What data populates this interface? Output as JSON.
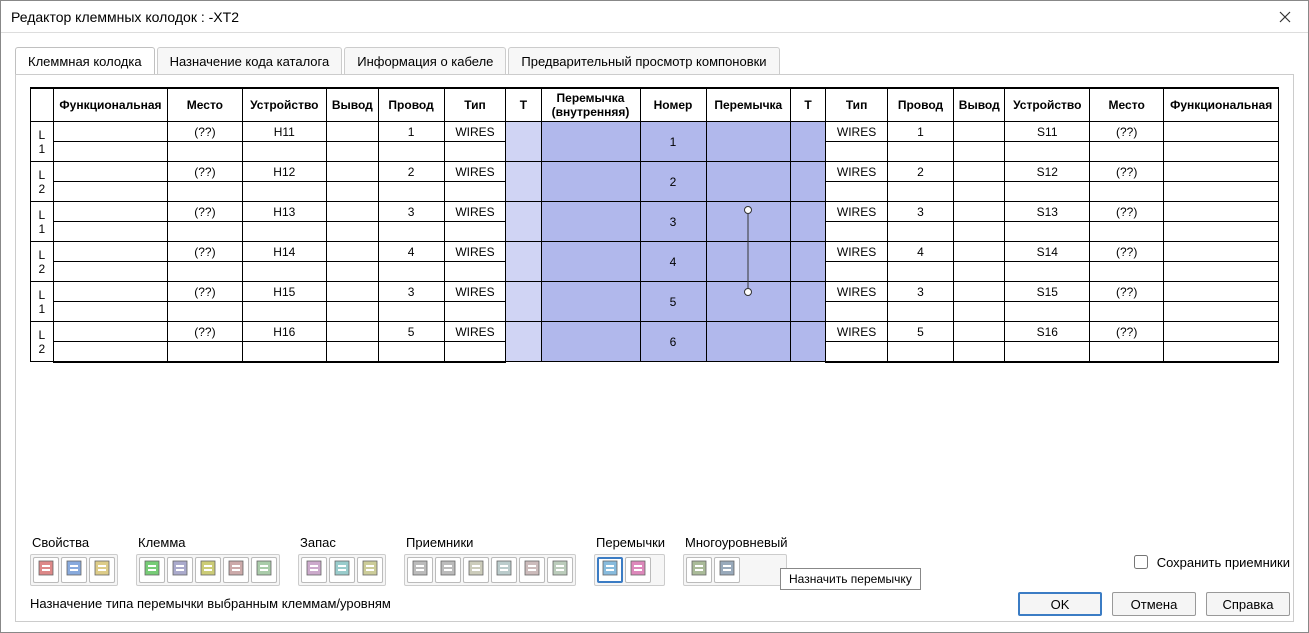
{
  "title": "Редактор клеммных колодок : -XT2",
  "tabs": [
    {
      "label": "Клеммная колодка",
      "active": true
    },
    {
      "label": "Назначение кода каталога",
      "active": false
    },
    {
      "label": "Информация о кабеле",
      "active": false
    },
    {
      "label": "Предварительный просмотр компоновки",
      "active": false
    }
  ],
  "headers": {
    "rownum": "",
    "left": [
      "Функциональная",
      "Место",
      "Устройство",
      "Вывод",
      "Провод",
      "Тип"
    ],
    "center": [
      "T",
      "Перемычка (внутренняя)",
      "Номер",
      "Перемычка",
      "T"
    ],
    "right": [
      "Тип",
      "Провод",
      "Вывод",
      "Устройство",
      "Место",
      "Функциональная"
    ]
  },
  "rows": [
    {
      "level": "L 1",
      "l_place": "(??)",
      "l_dev": "H11",
      "l_pin": "",
      "l_wire": "1",
      "l_type": "WIRES",
      "num": "1",
      "jumper": false,
      "r_type": "WIRES",
      "r_wire": "1",
      "r_pin": "",
      "r_dev": "S11",
      "r_place": "(??)"
    },
    {
      "level": "L 2",
      "l_place": "(??)",
      "l_dev": "H12",
      "l_pin": "",
      "l_wire": "2",
      "l_type": "WIRES",
      "num": "2",
      "jumper": false,
      "r_type": "WIRES",
      "r_wire": "2",
      "r_pin": "",
      "r_dev": "S12",
      "r_place": "(??)"
    },
    {
      "level": "L 1",
      "l_place": "(??)",
      "l_dev": "H13",
      "l_pin": "",
      "l_wire": "3",
      "l_type": "WIRES",
      "num": "3",
      "jumper": "start",
      "r_type": "WIRES",
      "r_wire": "3",
      "r_pin": "",
      "r_dev": "S13",
      "r_place": "(??)"
    },
    {
      "level": "L 2",
      "l_place": "(??)",
      "l_dev": "H14",
      "l_pin": "",
      "l_wire": "4",
      "l_type": "WIRES",
      "num": "4",
      "jumper": "mid",
      "r_type": "WIRES",
      "r_wire": "4",
      "r_pin": "",
      "r_dev": "S14",
      "r_place": "(??)"
    },
    {
      "level": "L 1",
      "l_place": "(??)",
      "l_dev": "H15",
      "l_pin": "",
      "l_wire": "3",
      "l_type": "WIRES",
      "num": "5",
      "jumper": "end",
      "r_type": "WIRES",
      "r_wire": "3",
      "r_pin": "",
      "r_dev": "S15",
      "r_place": "(??)"
    },
    {
      "level": "L 2",
      "l_place": "(??)",
      "l_dev": "H16",
      "l_pin": "",
      "l_wire": "5",
      "l_type": "WIRES",
      "num": "6",
      "jumper": false,
      "r_type": "WIRES",
      "r_wire": "5",
      "r_pin": "",
      "r_dev": "S16",
      "r_place": "(??)"
    }
  ],
  "groups": {
    "props": {
      "label": "Свойства",
      "icons": [
        "props-edit-icon",
        "props-copy-icon",
        "props-paste-icon"
      ]
    },
    "terminal": {
      "label": "Клемма",
      "icons": [
        "terminal-add-icon",
        "terminal-insert-icon",
        "terminal-renum-icon",
        "terminal-mvup-icon",
        "terminal-mvdn-icon"
      ]
    },
    "spare": {
      "label": "Запас",
      "icons": [
        "spare-insert-icon",
        "spare-down-icon",
        "spare-up-icon"
      ]
    },
    "receivers": {
      "label": "Приемники",
      "icons": [
        "recv-up-icon",
        "recv-down-icon",
        "recv-tri-icon",
        "recv-page-icon",
        "recv-list-icon",
        "recv-block-icon"
      ]
    },
    "jumpers": {
      "label": "Перемычки",
      "icons": [
        "jumper-assign-icon",
        "jumper-remove-icon"
      ],
      "active": 0
    },
    "multi": {
      "label": "Многоуровневый",
      "icons": [
        "multi-in-icon",
        "multi-out-icon"
      ]
    }
  },
  "status": "Назначение типа перемычки выбранным клеммам/уровням",
  "tooltip": "Назначить перемычку",
  "checkbox": "Сохранить приемники",
  "buttons": {
    "ok": "OK",
    "cancel": "Отмена",
    "help": "Справка"
  }
}
